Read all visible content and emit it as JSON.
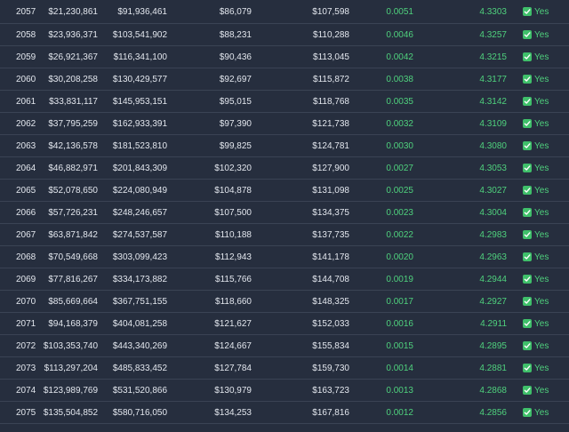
{
  "colors": {
    "background": "#262e3e",
    "row_divider": "#3a4354",
    "text": "#e3e7ee",
    "positive": "#4fd17d",
    "check_fill": "#3fbf6a"
  },
  "status_icon": "check-icon",
  "rows": [
    {
      "year": "2057",
      "col1": "$21,230,861",
      "col2": "$91,936,461",
      "col3": "$86,079",
      "col4": "$107,598",
      "ratio": "0.0051",
      "mult": "4.3303",
      "status": "Yes"
    },
    {
      "year": "2058",
      "col1": "$23,936,371",
      "col2": "$103,541,902",
      "col3": "$88,231",
      "col4": "$110,288",
      "ratio": "0.0046",
      "mult": "4.3257",
      "status": "Yes"
    },
    {
      "year": "2059",
      "col1": "$26,921,367",
      "col2": "$116,341,100",
      "col3": "$90,436",
      "col4": "$113,045",
      "ratio": "0.0042",
      "mult": "4.3215",
      "status": "Yes"
    },
    {
      "year": "2060",
      "col1": "$30,208,258",
      "col2": "$130,429,577",
      "col3": "$92,697",
      "col4": "$115,872",
      "ratio": "0.0038",
      "mult": "4.3177",
      "status": "Yes"
    },
    {
      "year": "2061",
      "col1": "$33,831,117",
      "col2": "$145,953,151",
      "col3": "$95,015",
      "col4": "$118,768",
      "ratio": "0.0035",
      "mult": "4.3142",
      "status": "Yes"
    },
    {
      "year": "2062",
      "col1": "$37,795,259",
      "col2": "$162,933,391",
      "col3": "$97,390",
      "col4": "$121,738",
      "ratio": "0.0032",
      "mult": "4.3109",
      "status": "Yes"
    },
    {
      "year": "2063",
      "col1": "$42,136,578",
      "col2": "$181,523,810",
      "col3": "$99,825",
      "col4": "$124,781",
      "ratio": "0.0030",
      "mult": "4.3080",
      "status": "Yes"
    },
    {
      "year": "2064",
      "col1": "$46,882,971",
      "col2": "$201,843,309",
      "col3": "$102,320",
      "col4": "$127,900",
      "ratio": "0.0027",
      "mult": "4.3053",
      "status": "Yes"
    },
    {
      "year": "2065",
      "col1": "$52,078,650",
      "col2": "$224,080,949",
      "col3": "$104,878",
      "col4": "$131,098",
      "ratio": "0.0025",
      "mult": "4.3027",
      "status": "Yes"
    },
    {
      "year": "2066",
      "col1": "$57,726,231",
      "col2": "$248,246,657",
      "col3": "$107,500",
      "col4": "$134,375",
      "ratio": "0.0023",
      "mult": "4.3004",
      "status": "Yes"
    },
    {
      "year": "2067",
      "col1": "$63,871,842",
      "col2": "$274,537,587",
      "col3": "$110,188",
      "col4": "$137,735",
      "ratio": "0.0022",
      "mult": "4.2983",
      "status": "Yes"
    },
    {
      "year": "2068",
      "col1": "$70,549,668",
      "col2": "$303,099,423",
      "col3": "$112,943",
      "col4": "$141,178",
      "ratio": "0.0020",
      "mult": "4.2963",
      "status": "Yes"
    },
    {
      "year": "2069",
      "col1": "$77,816,267",
      "col2": "$334,173,882",
      "col3": "$115,766",
      "col4": "$144,708",
      "ratio": "0.0019",
      "mult": "4.2944",
      "status": "Yes"
    },
    {
      "year": "2070",
      "col1": "$85,669,664",
      "col2": "$367,751,155",
      "col3": "$118,660",
      "col4": "$148,325",
      "ratio": "0.0017",
      "mult": "4.2927",
      "status": "Yes"
    },
    {
      "year": "2071",
      "col1": "$94,168,379",
      "col2": "$404,081,258",
      "col3": "$121,627",
      "col4": "$152,033",
      "ratio": "0.0016",
      "mult": "4.2911",
      "status": "Yes"
    },
    {
      "year": "2072",
      "col1": "$103,353,740",
      "col2": "$443,340,269",
      "col3": "$124,667",
      "col4": "$155,834",
      "ratio": "0.0015",
      "mult": "4.2895",
      "status": "Yes"
    },
    {
      "year": "2073",
      "col1": "$113,297,204",
      "col2": "$485,833,452",
      "col3": "$127,784",
      "col4": "$159,730",
      "ratio": "0.0014",
      "mult": "4.2881",
      "status": "Yes"
    },
    {
      "year": "2074",
      "col1": "$123,989,769",
      "col2": "$531,520,866",
      "col3": "$130,979",
      "col4": "$163,723",
      "ratio": "0.0013",
      "mult": "4.2868",
      "status": "Yes"
    },
    {
      "year": "2075",
      "col1": "$135,504,852",
      "col2": "$580,716,050",
      "col3": "$134,253",
      "col4": "$167,816",
      "ratio": "0.0012",
      "mult": "4.2856",
      "status": "Yes"
    }
  ]
}
